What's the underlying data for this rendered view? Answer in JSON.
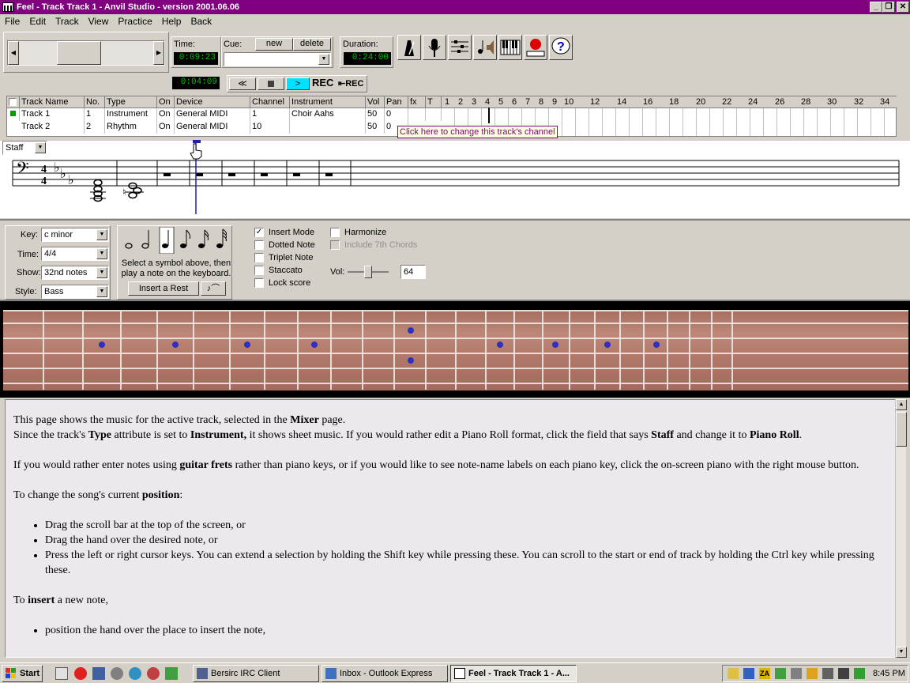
{
  "window": {
    "title": "Feel - Track Track 1 - Anvil Studio - version 2001.06.06",
    "min": "_",
    "max": "❐",
    "close": "✕"
  },
  "menu": [
    "File",
    "Edit",
    "Track",
    "View",
    "Practice",
    "Help",
    "Back"
  ],
  "transport": {
    "time_label": "Time:",
    "time_value": "0:09:23",
    "cue_label": "Cue:",
    "new_label": "new",
    "delete_label": "delete",
    "duration_label": "Duration:",
    "duration_value": "0:24:00",
    "position_value": "0:04:09",
    "rec_label": "REC",
    "rec2_label": "REC"
  },
  "grid": {
    "headers": [
      "Track Name",
      "No.",
      "Type",
      "On",
      "Device",
      "Channel",
      "Instrument",
      "Vol",
      "Pan",
      "fx",
      "T"
    ],
    "measures": [
      "1",
      "2",
      "3",
      "4",
      "5",
      "6",
      "7",
      "8",
      "9",
      "10",
      "12",
      "14",
      "16",
      "18",
      "20",
      "22",
      "24",
      "26",
      "28",
      "30",
      "32",
      "34"
    ],
    "rows": [
      [
        "Track 1",
        "1",
        "Instrument",
        "On",
        "General MIDI",
        "1",
        "Choir Aahs",
        "50",
        "0"
      ],
      [
        "Track 2",
        "2",
        "Rhythm",
        "On",
        "General MIDI",
        "10",
        "",
        "50",
        "0"
      ]
    ],
    "tooltip": "Click here to change this track's channel"
  },
  "view_select": "Staff",
  "controls": {
    "key_label": "Key:",
    "key_value": "c minor",
    "time_label": "Time:",
    "time_value": "4/4",
    "show_label": "Show:",
    "show_value": "32nd notes",
    "style_label": "Style:",
    "style_value": "Bass",
    "symbol_hint": "Select a symbol above, then play a note on the keyboard.",
    "insert_rest": "Insert a Rest",
    "options": [
      {
        "label": "Insert Mode",
        "checked": true
      },
      {
        "label": "Dotted Note",
        "checked": false
      },
      {
        "label": "Triplet Note",
        "checked": false
      },
      {
        "label": "Staccato",
        "checked": false
      },
      {
        "label": "Lock score",
        "checked": false
      }
    ],
    "harmonize": "Harmonize",
    "include7": "Include 7th Chords",
    "vol_label": "Vol:",
    "vol_value": "64"
  },
  "help": {
    "p1a": "This page shows the music for the active track, selected in the ",
    "p1b": "Mixer",
    "p1c": " page.",
    "p2a": "Since the track's ",
    "p2b": "Type",
    "p2c": " attribute is set to ",
    "p2d": "Instrument,",
    "p2e": " it shows sheet music. If you would rather edit a Piano Roll format, click the field that says ",
    "p2f": "Staff",
    "p2g": " and change it to ",
    "p2h": "Piano Roll",
    "p3a": "If you would rather enter notes using ",
    "p3b": "guitar frets",
    "p3c": " rather than piano keys, or if you would like to see note-name labels on each piano key, click the on-screen piano with the right mouse button.",
    "p4a": "To change the song's current ",
    "p4b": "position",
    "bullets": [
      "Drag the scroll bar at the top of the screen, or",
      "Drag the hand over the desired note, or",
      "Press the left or right cursor keys. You can extend a selection by holding the Shift key while pressing these. You can scroll to the start or end of track by holding the Ctrl key while pressing these."
    ],
    "p5a": "To ",
    "p5b": "insert",
    "p5c": " a new note,",
    "bullet2": "position the hand over the place to insert the note,"
  },
  "taskbar": {
    "start": "Start",
    "tasks": [
      "Bersirc IRC Client",
      "Inbox - Outlook Express",
      "Feel - Track Track 1 - A..."
    ],
    "clock": "8:45 PM"
  }
}
